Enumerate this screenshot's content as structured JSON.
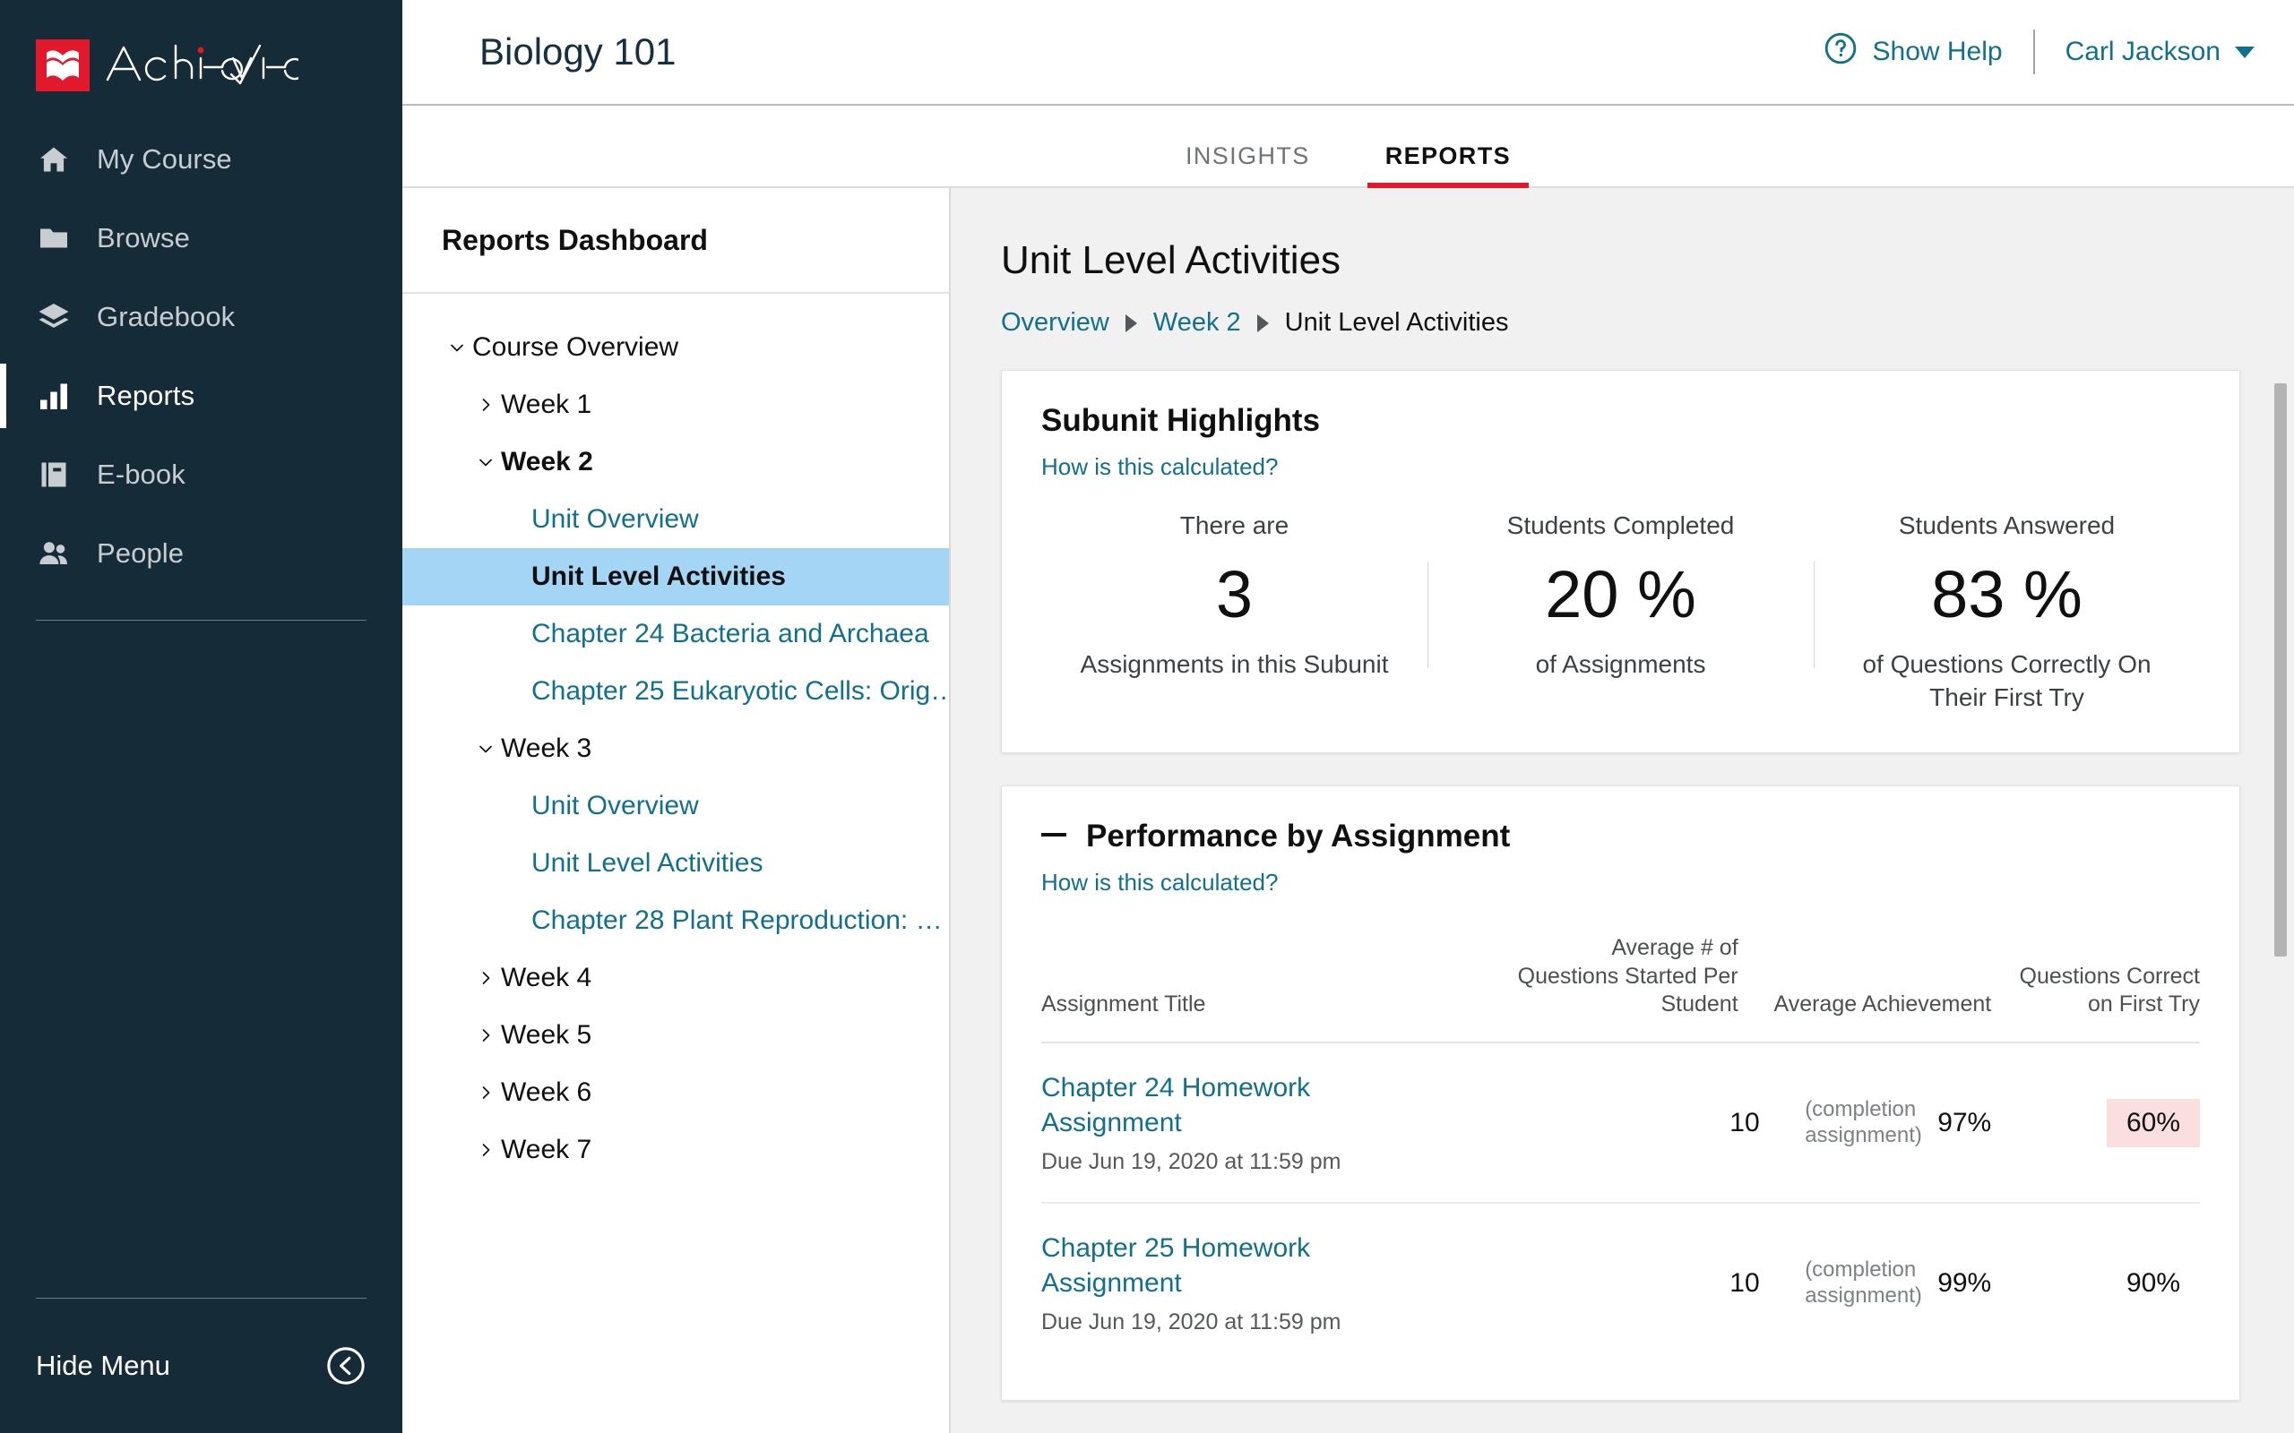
{
  "brand": {
    "name": "Achieve",
    "logo_icon": "achieve-book-mark",
    "accent_red": "#e2182c"
  },
  "sidebar": {
    "items": [
      {
        "label": "My Course",
        "icon": "home-icon",
        "active": false
      },
      {
        "label": "Browse",
        "icon": "folder-icon",
        "active": false
      },
      {
        "label": "Gradebook",
        "icon": "layers-icon",
        "active": false
      },
      {
        "label": "Reports",
        "icon": "bar-chart-icon",
        "active": true
      },
      {
        "label": "E-book",
        "icon": "book-icon",
        "active": false
      },
      {
        "label": "People",
        "icon": "people-icon",
        "active": false
      }
    ],
    "hide_menu": {
      "label": "Hide Menu",
      "icon": "chevron-left-circle-icon"
    }
  },
  "topbar": {
    "course_title": "Biology 101",
    "help": {
      "label": "Show Help",
      "icon": "question-circle-icon"
    },
    "user": {
      "name": "Carl Jackson",
      "icon": "caret-down-icon"
    }
  },
  "tabs": [
    {
      "label": "INSIGHTS",
      "active": false
    },
    {
      "label": "REPORTS",
      "active": true
    }
  ],
  "tree": {
    "title": "Reports Dashboard",
    "nodes": [
      {
        "label": "Course Overview",
        "level": 0,
        "state": "expanded",
        "link": false,
        "selected": false,
        "bold": false
      },
      {
        "label": "Week 1",
        "level": 1,
        "state": "collapsed",
        "link": false,
        "selected": false,
        "bold": false
      },
      {
        "label": "Week 2",
        "level": 1,
        "state": "expanded",
        "link": false,
        "selected": false,
        "bold": true
      },
      {
        "label": "Unit Overview",
        "level": 2,
        "state": "none",
        "link": true,
        "selected": false,
        "bold": false
      },
      {
        "label": "Unit Level Activities",
        "level": 2,
        "state": "none",
        "link": true,
        "selected": true,
        "bold": true
      },
      {
        "label": "Chapter 24 Bacteria and Archaea",
        "level": 2,
        "state": "none",
        "link": true,
        "selected": false,
        "bold": false
      },
      {
        "label": "Chapter 25 Eukaryotic Cells: Orig…",
        "level": 2,
        "state": "none",
        "link": true,
        "selected": false,
        "bold": false
      },
      {
        "label": "Week 3",
        "level": 1,
        "state": "expanded",
        "link": false,
        "selected": false,
        "bold": false
      },
      {
        "label": "Unit Overview",
        "level": 2,
        "state": "none",
        "link": true,
        "selected": false,
        "bold": false
      },
      {
        "label": "Unit Level Activities",
        "level": 2,
        "state": "none",
        "link": true,
        "selected": false,
        "bold": false
      },
      {
        "label": "Chapter 28 Plant Reproduction: …",
        "level": 2,
        "state": "none",
        "link": true,
        "selected": false,
        "bold": false
      },
      {
        "label": "Week 4",
        "level": 1,
        "state": "collapsed",
        "link": false,
        "selected": false,
        "bold": false
      },
      {
        "label": "Week 5",
        "level": 1,
        "state": "collapsed",
        "link": false,
        "selected": false,
        "bold": false
      },
      {
        "label": "Week 6",
        "level": 1,
        "state": "collapsed",
        "link": false,
        "selected": false,
        "bold": false
      },
      {
        "label": "Week 7",
        "level": 1,
        "state": "collapsed",
        "link": false,
        "selected": false,
        "bold": false
      }
    ]
  },
  "page": {
    "title": "Unit Level Activities",
    "breadcrumb": [
      {
        "label": "Overview",
        "link": true
      },
      {
        "label": "Week 2",
        "link": true
      },
      {
        "label": "Unit Level Activities",
        "link": false
      }
    ]
  },
  "subunit_highlights": {
    "title": "Subunit Highlights",
    "how_link": "How is this calculated?",
    "stats": [
      {
        "top": "There are",
        "value": "3",
        "bottom": "Assignments in this Subunit"
      },
      {
        "top": "Students Completed",
        "value": "20 %",
        "bottom": "of Assignments"
      },
      {
        "top": "Students Answered",
        "value": "83 %",
        "bottom": "of Questions Correctly On Their First Try"
      }
    ]
  },
  "performance": {
    "title": "Performance by Assignment",
    "collapse_icon": "minus-icon",
    "how_link": "How is this calculated?",
    "columns": {
      "title": "Assignment Title",
      "questions": "Average # of Questions Started Per Student",
      "achievement": "Average Achievement",
      "first_try": "Questions Correct on First Try"
    },
    "rows": [
      {
        "name": "Chapter 24 Homework Assignment",
        "due": "Due Jun 19, 2020 at 11:59 pm",
        "questions": "10",
        "achievement_note": "(completion assignment)",
        "achievement": "97%",
        "first_try": "60%",
        "first_try_flag": "low"
      },
      {
        "name": "Chapter 25 Homework Assignment",
        "due": "Due Jun 19, 2020 at 11:59 pm",
        "questions": "10",
        "achievement_note": "(completion assignment)",
        "achievement": "99%",
        "first_try": "90%",
        "first_try_flag": "none"
      }
    ]
  },
  "colors": {
    "sidebar_bg": "#152b38",
    "link_teal": "#11708c",
    "tab_active_red": "#e2182c",
    "tree_selected_blue": "#a5d5f5",
    "low_badge_pink": "#fbdedf"
  }
}
